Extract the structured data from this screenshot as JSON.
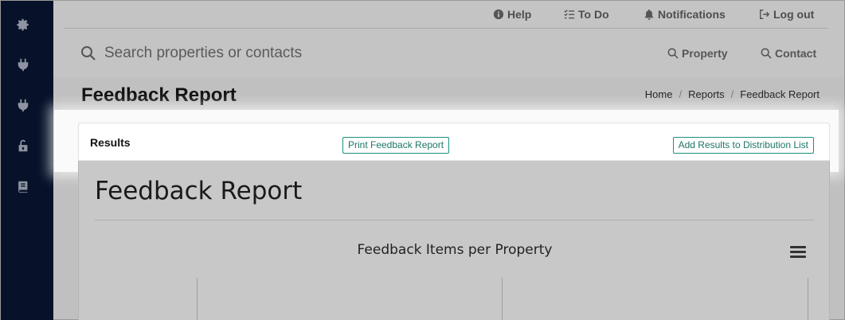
{
  "sidebar": {
    "items": [
      {
        "icon": "gear-icon"
      },
      {
        "icon": "plug-icon"
      },
      {
        "icon": "plug-icon"
      },
      {
        "icon": "lock-icon"
      },
      {
        "icon": "book-icon"
      }
    ]
  },
  "topnav": {
    "help": "Help",
    "todo": "To Do",
    "notifications": "Notifications",
    "logout": "Log out"
  },
  "search": {
    "placeholder": "Search properties or contacts",
    "property_label": "Property",
    "contact_label": "Contact"
  },
  "page": {
    "title": "Feedback Report",
    "breadcrumb": [
      "Home",
      "Reports",
      "Feedback Report"
    ]
  },
  "results_card": {
    "title": "Results",
    "print_button": "Print Feedback Report",
    "distribution_button": "Add Results to Distribution List"
  },
  "report": {
    "heading": "Feedback Report",
    "chart_title": "Feedback Items per Property"
  },
  "colors": {
    "sidebar_bg": "#07122a",
    "accent": "#1f8f7e"
  }
}
